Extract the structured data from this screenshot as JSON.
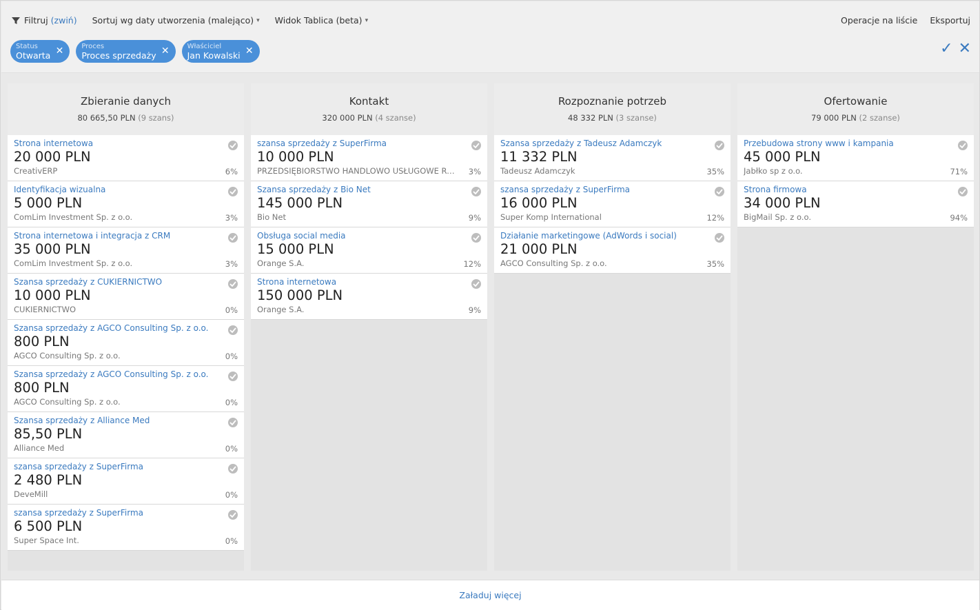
{
  "toolbar": {
    "filter_label": "Filtruj",
    "filter_toggle": "(zwiń)",
    "sort_label": "Sortuj wg daty utworzenia (malejąco)",
    "view_label": "Widok Tablica (beta)",
    "list_ops": "Operacje na liście",
    "export": "Eksportuj"
  },
  "filters": [
    {
      "label": "Status",
      "value": "Otwarta"
    },
    {
      "label": "Proces",
      "value": "Proces sprzedaży"
    },
    {
      "label": "Właściciel",
      "value": "Jan Kowalski"
    }
  ],
  "columns": [
    {
      "title": "Zbieranie danych",
      "sum": "80 665,50 PLN",
      "count": "(9 szans)",
      "cards": [
        {
          "title": "Strona internetowa",
          "value": "20 000 PLN",
          "company": "CreativERP",
          "pct": "6%"
        },
        {
          "title": "Identyfikacja wizualna",
          "value": "5 000 PLN",
          "company": "ComLim Investment Sp. z o.o.",
          "pct": "3%"
        },
        {
          "title": "Strona internetowa i integracja z CRM",
          "value": "35 000 PLN",
          "company": "ComLim Investment Sp. z o.o.",
          "pct": "3%"
        },
        {
          "title": "Szansa sprzedaży z CUKIERNICTWO",
          "value": "10 000 PLN",
          "company": "CUKIERNICTWO",
          "pct": "0%"
        },
        {
          "title": "Szansa sprzedaży z AGCO Consulting Sp. z o.o.",
          "value": "800 PLN",
          "company": "AGCO Consulting Sp. z o.o.",
          "pct": "0%"
        },
        {
          "title": "Szansa sprzedaży z AGCO Consulting Sp. z o.o.",
          "value": "800 PLN",
          "company": "AGCO Consulting Sp. z o.o.",
          "pct": "0%"
        },
        {
          "title": "Szansa sprzedaży z Alliance Med",
          "value": "85,50 PLN",
          "company": "Alliance Med",
          "pct": "0%"
        },
        {
          "title": "szansa sprzedaży z SuperFirma",
          "value": "2 480 PLN",
          "company": "DeveMill",
          "pct": "0%"
        },
        {
          "title": "szansa sprzedaży z SuperFirma",
          "value": "6 500 PLN",
          "company": "Super Space Int.",
          "pct": "0%"
        }
      ]
    },
    {
      "title": "Kontakt",
      "sum": "320 000 PLN",
      "count": "(4 szanse)",
      "cards": [
        {
          "title": "szansa sprzedaży z SuperFirma",
          "value": "10 000 PLN",
          "company": "PRZEDSIĘBIORSTWO HANDLOWO USŁUGOWE RAKOWSKI",
          "pct": "3%"
        },
        {
          "title": "Szansa sprzedaży z Bio Net",
          "value": "145 000 PLN",
          "company": "Bio Net",
          "pct": "9%"
        },
        {
          "title": "Obsługa social media",
          "value": "15 000 PLN",
          "company": "Orange S.A.",
          "pct": "12%"
        },
        {
          "title": "Strona internetowa",
          "value": "150 000 PLN",
          "company": "Orange S.A.",
          "pct": "9%"
        }
      ]
    },
    {
      "title": "Rozpoznanie potrzeb",
      "sum": "48 332 PLN",
      "count": "(3 szanse)",
      "cards": [
        {
          "title": "Szansa sprzedaży z Tadeusz Adamczyk",
          "value": "11 332 PLN",
          "company": "Tadeusz Adamczyk",
          "pct": "35%"
        },
        {
          "title": "szansa sprzedaży z SuperFirma",
          "value": "16 000 PLN",
          "company": "Super Komp International",
          "pct": "12%"
        },
        {
          "title": "Działanie marketingowe (AdWords i social)",
          "value": "21 000 PLN",
          "company": "AGCO Consulting Sp. z o.o.",
          "pct": "35%"
        }
      ]
    },
    {
      "title": "Ofertowanie",
      "sum": "79 000 PLN",
      "count": "(2 szanse)",
      "cards": [
        {
          "title": "Przebudowa strony www i kampania",
          "value": "45 000 PLN",
          "company": "Jabłko sp z o.o.",
          "pct": "71%"
        },
        {
          "title": "Strona firmowa",
          "value": "34 000 PLN",
          "company": "BigMail Sp. z o.o.",
          "pct": "94%"
        }
      ]
    }
  ],
  "footer": {
    "load_more": "Załaduj więcej"
  }
}
